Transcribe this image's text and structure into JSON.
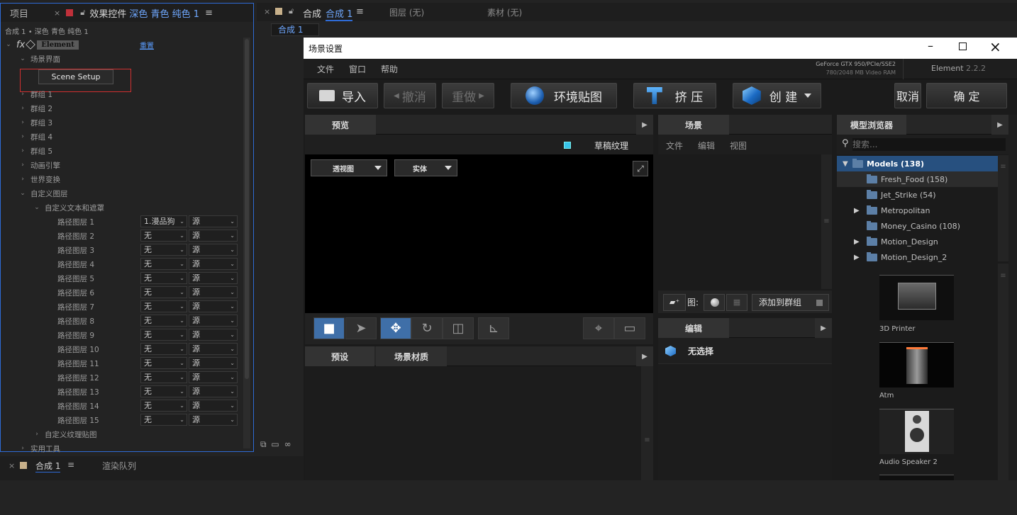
{
  "left_panel": {
    "tab_project": "项目",
    "tab_effects": "效果控件",
    "tab_effects_layer": "深色 青色 纯色 1",
    "breadcrumb": "合成 1 • 深色 青色 纯色 1",
    "fx_label": "fx",
    "effect_name": "Element",
    "reset": "重置",
    "scene_interface": "场景界面",
    "scene_setup_btn": "Scene Setup",
    "groups": [
      "群组  1",
      "群组  2",
      "群组  3",
      "群组  4",
      "群组  5"
    ],
    "animation_engine": "动画引擎",
    "world_transform": "世界变换",
    "custom_layers": "自定义图层",
    "custom_text_mask": "自定义文本和遮罩",
    "paths": [
      {
        "label": "路径图层 1",
        "v1": "1.漫品狗",
        "v2": "源"
      },
      {
        "label": "路径图层 2",
        "v1": "无",
        "v2": "源"
      },
      {
        "label": "路径图层 3",
        "v1": "无",
        "v2": "源"
      },
      {
        "label": "路径图层 4",
        "v1": "无",
        "v2": "源"
      },
      {
        "label": "路径图层 5",
        "v1": "无",
        "v2": "源"
      },
      {
        "label": "路径图层 6",
        "v1": "无",
        "v2": "源"
      },
      {
        "label": "路径图层 7",
        "v1": "无",
        "v2": "源"
      },
      {
        "label": "路径图层 8",
        "v1": "无",
        "v2": "源"
      },
      {
        "label": "路径图层 9",
        "v1": "无",
        "v2": "源"
      },
      {
        "label": "路径图层 10",
        "v1": "无",
        "v2": "源"
      },
      {
        "label": "路径图层 11",
        "v1": "无",
        "v2": "源"
      },
      {
        "label": "路径图层 12",
        "v1": "无",
        "v2": "源"
      },
      {
        "label": "路径图层 13",
        "v1": "无",
        "v2": "源"
      },
      {
        "label": "路径图层 14",
        "v1": "无",
        "v2": "源"
      },
      {
        "label": "路径图层 15",
        "v1": "无",
        "v2": "源"
      }
    ],
    "custom_texture": "自定义纹理贴图",
    "utilities": "实用工具"
  },
  "bottom_left": {
    "tab_comp": "合成 1",
    "tab_render": "渲染队列"
  },
  "comp_panel": {
    "tab_comp_prefix": "合成",
    "tab_comp_name": "合成 1",
    "tab_layer": "图层  (无)",
    "tab_footage": "素材  (无)",
    "subtab": "合成 1"
  },
  "dialog": {
    "title": "场景设置",
    "menu": [
      "文件",
      "窗口",
      "帮助"
    ],
    "gpu_line1": "GeForce GTX 950/PCIe/SSE2",
    "gpu_line2": "780/2048 MB Video RAM",
    "app_name": "Element",
    "app_version": "2.2.2",
    "toolbar": {
      "import": "导入",
      "undo": "撤消",
      "redo": "重做",
      "env": "环境贴图",
      "extrude": "挤 压",
      "create": "创 建",
      "cancel": "取消",
      "ok": "确 定"
    },
    "preview": {
      "tab": "预览",
      "draft_texture": "草稿纹理",
      "view_select": "透视图",
      "shade_select": "实体"
    },
    "scene": {
      "tab": "场景",
      "menu": [
        "文件",
        "编辑",
        "视图"
      ],
      "img_label": "图:",
      "add_group": "添加到群组"
    },
    "edit": {
      "tab": "编辑",
      "no_selection": "无选择"
    },
    "presets": {
      "tab_presets": "预设",
      "tab_materials": "场景材质"
    },
    "browser": {
      "tab": "模型浏览器",
      "search_placeholder": "搜索...",
      "tree": [
        {
          "label": "Models (138)",
          "expanded": true
        },
        {
          "label": "Fresh_Food (158)"
        },
        {
          "label": "Jet_Strike (54)"
        },
        {
          "label": "Metropolitan"
        },
        {
          "label": "Money_Casino (108)"
        },
        {
          "label": "Motion_Design"
        },
        {
          "label": "Motion_Design_2"
        }
      ],
      "thumbs": [
        "3D Printer",
        "Atm",
        "Audio Speaker 2"
      ]
    }
  },
  "colors": {
    "accent_blue": "#2e6bd6",
    "dialog_bg": "#1b1b1b",
    "tool_active": "#3f6fa8",
    "tree_selected": "#27507f"
  }
}
